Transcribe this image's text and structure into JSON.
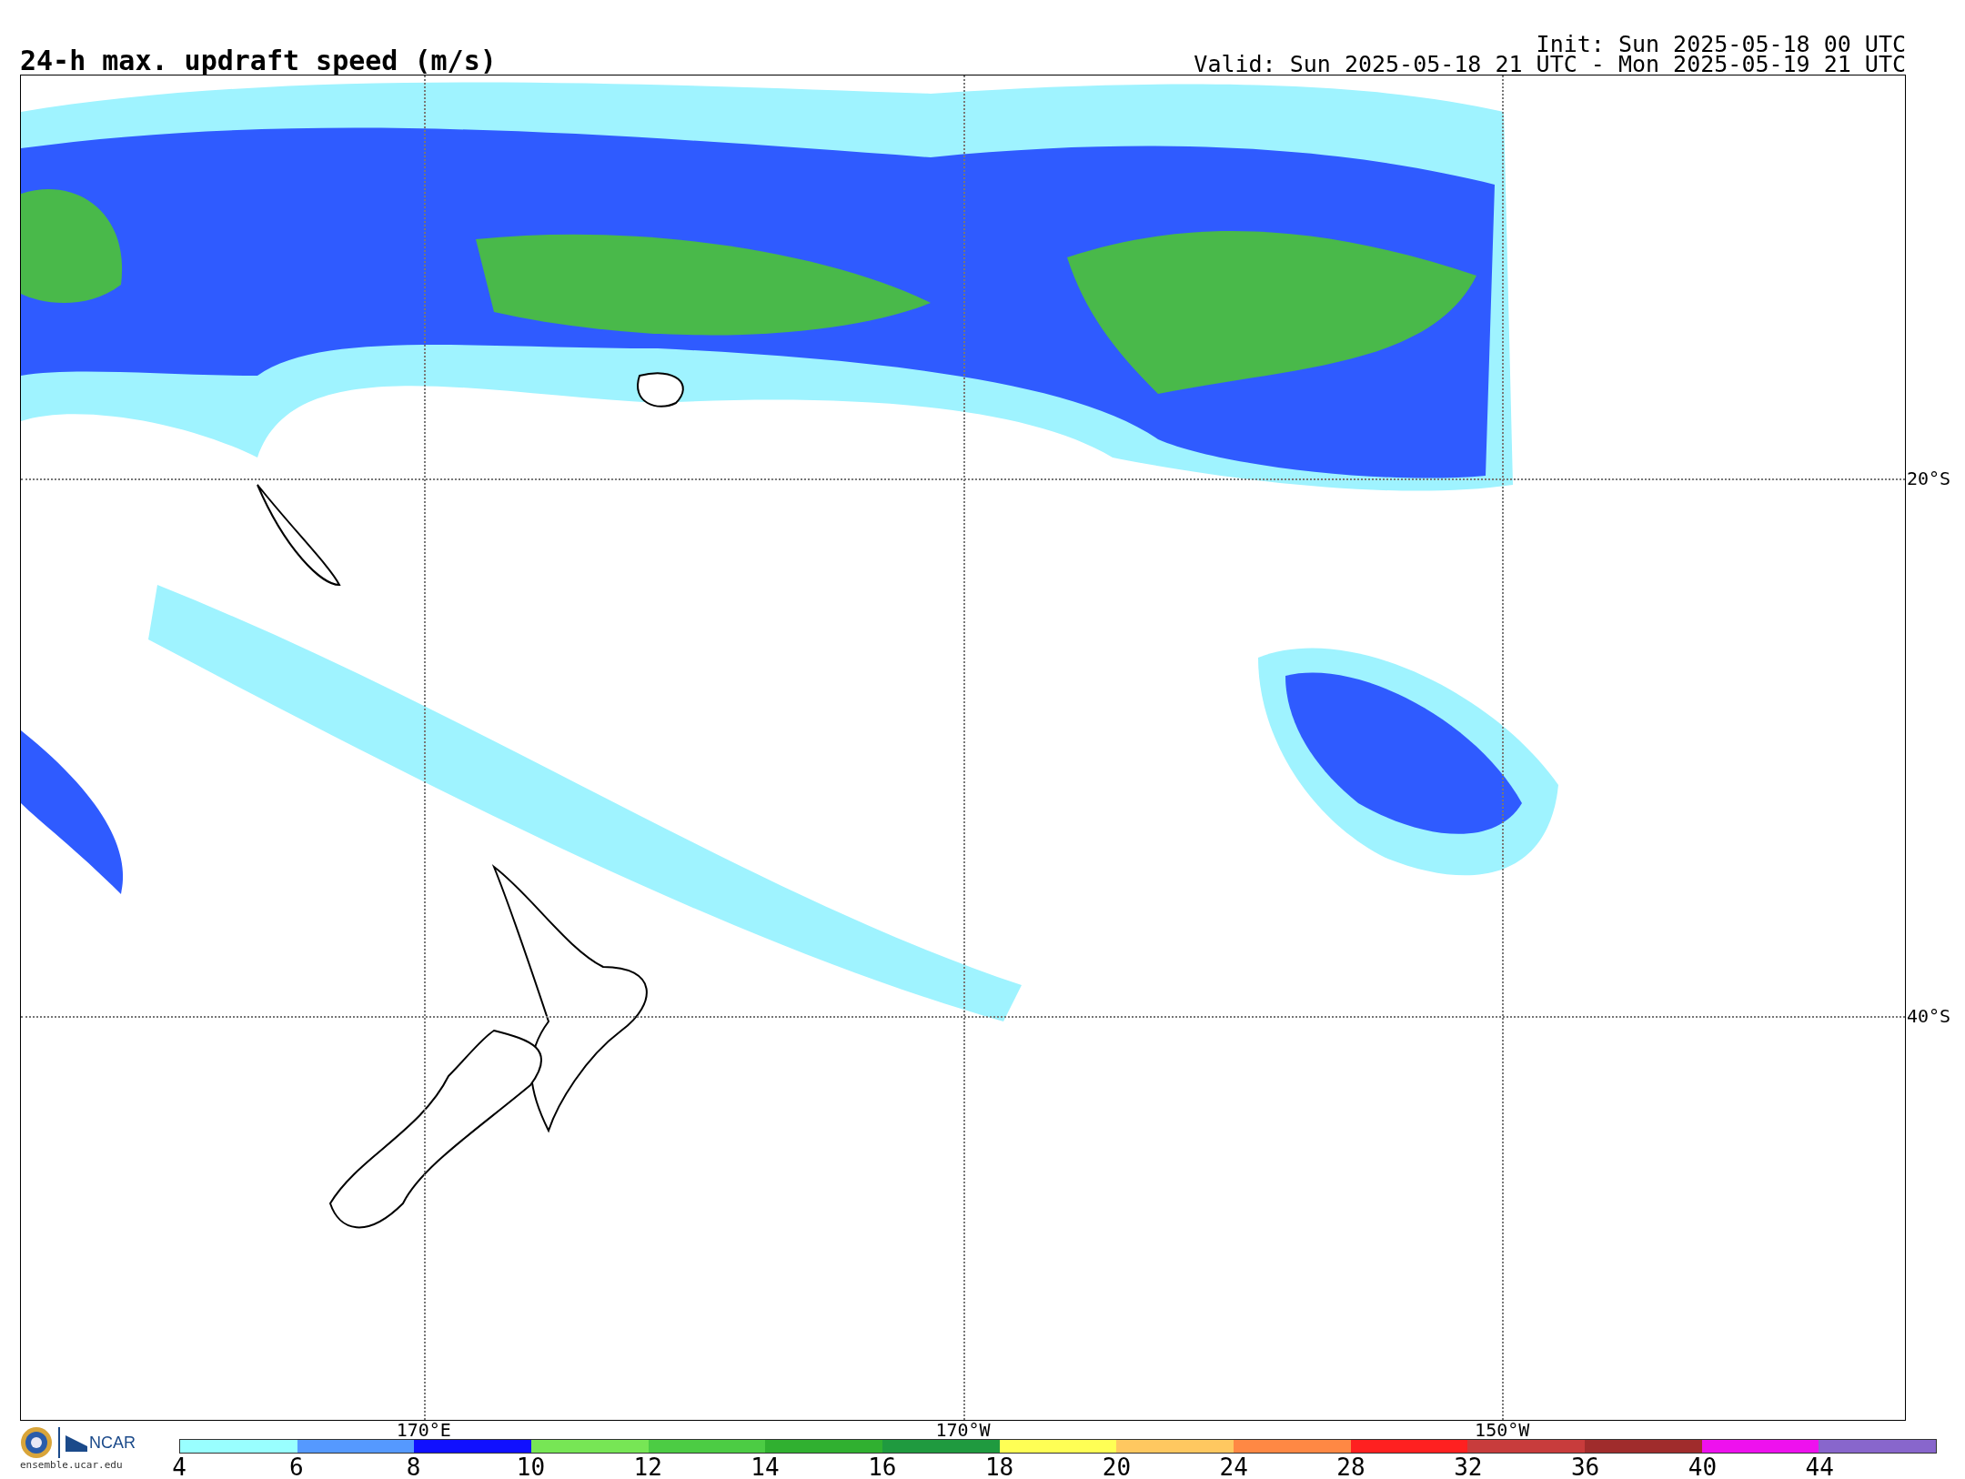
{
  "title": "24-h max. updraft speed (m/s)",
  "init": "Init: Sun 2025-05-18 00 UTC",
  "valid": "Valid: Sun 2025-05-18 21 UTC - Mon 2025-05-19 21 UTC",
  "map": {
    "longitudes": [
      "170°E",
      "170°W",
      "150°W"
    ],
    "latitudes": [
      "20°S",
      "40°S"
    ]
  },
  "logo": {
    "name": "NCAR",
    "url": "ensemble.ucar.edu"
  },
  "colorbar": {
    "bins": [
      {
        "color": "#99ffff"
      },
      {
        "color": "#5599ff"
      },
      {
        "color": "#1010ff"
      },
      {
        "color": "#77e655"
      },
      {
        "color": "#4ccc44"
      },
      {
        "color": "#30b030"
      },
      {
        "color": "#1f9a3f"
      },
      {
        "color": "#ffff55"
      },
      {
        "color": "#ffc860"
      },
      {
        "color": "#ff8844"
      },
      {
        "color": "#ff2020"
      },
      {
        "color": "#c83c3c"
      },
      {
        "color": "#a02c2c"
      },
      {
        "color": "#ee11ee"
      },
      {
        "color": "#8866cc"
      }
    ],
    "ticks": [
      "4",
      "6",
      "8",
      "10",
      "12",
      "14",
      "16",
      "18",
      "20",
      "24",
      "28",
      "32",
      "36",
      "40",
      "44"
    ]
  }
}
